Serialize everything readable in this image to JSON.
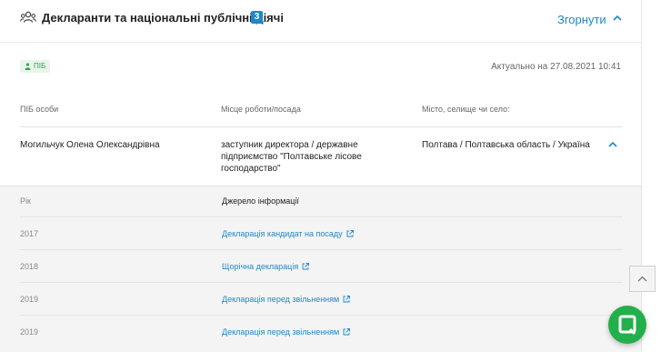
{
  "header": {
    "title": "Декларанти та національні публічні діячі",
    "count": "3",
    "collapse_label": "Згорнути"
  },
  "filter": {
    "tag_label": "ПІБ",
    "updated": "Актуально на 27.08.2021 10:41"
  },
  "table": {
    "columns": [
      "ПІБ особи",
      "Місце роботи/посада",
      "Місто, селище чи село:"
    ],
    "row": {
      "name": "Могильчук Олена Олександрівна",
      "position_lines": [
        "заступник директора / державне",
        "підприємство \"Полтавське лісове",
        "господарство\""
      ],
      "city": "Полтава / Полтавська область / Україна"
    }
  },
  "declarations": {
    "headers": {
      "year": "Рік",
      "source": "Джерело інформації"
    },
    "items": [
      {
        "year": "2017",
        "source": "Декларація кандидат на посаду"
      },
      {
        "year": "2018",
        "source": "Щорічна декларація"
      },
      {
        "year": "2019",
        "source": "Декларація перед звільненням"
      },
      {
        "year": "2019",
        "source": "Декларація перед звільненням"
      }
    ]
  },
  "colors": {
    "accent": "#1e88c7",
    "tag_bg": "#e7f5ea",
    "tag_text": "#3a9d52",
    "fab": "#22b04b"
  },
  "icons": {
    "header": "users-icon",
    "collapse": "chevron-up-icon",
    "external": "external-link-icon",
    "scroll": "chevron-up-icon",
    "fab": "chat-icon"
  }
}
